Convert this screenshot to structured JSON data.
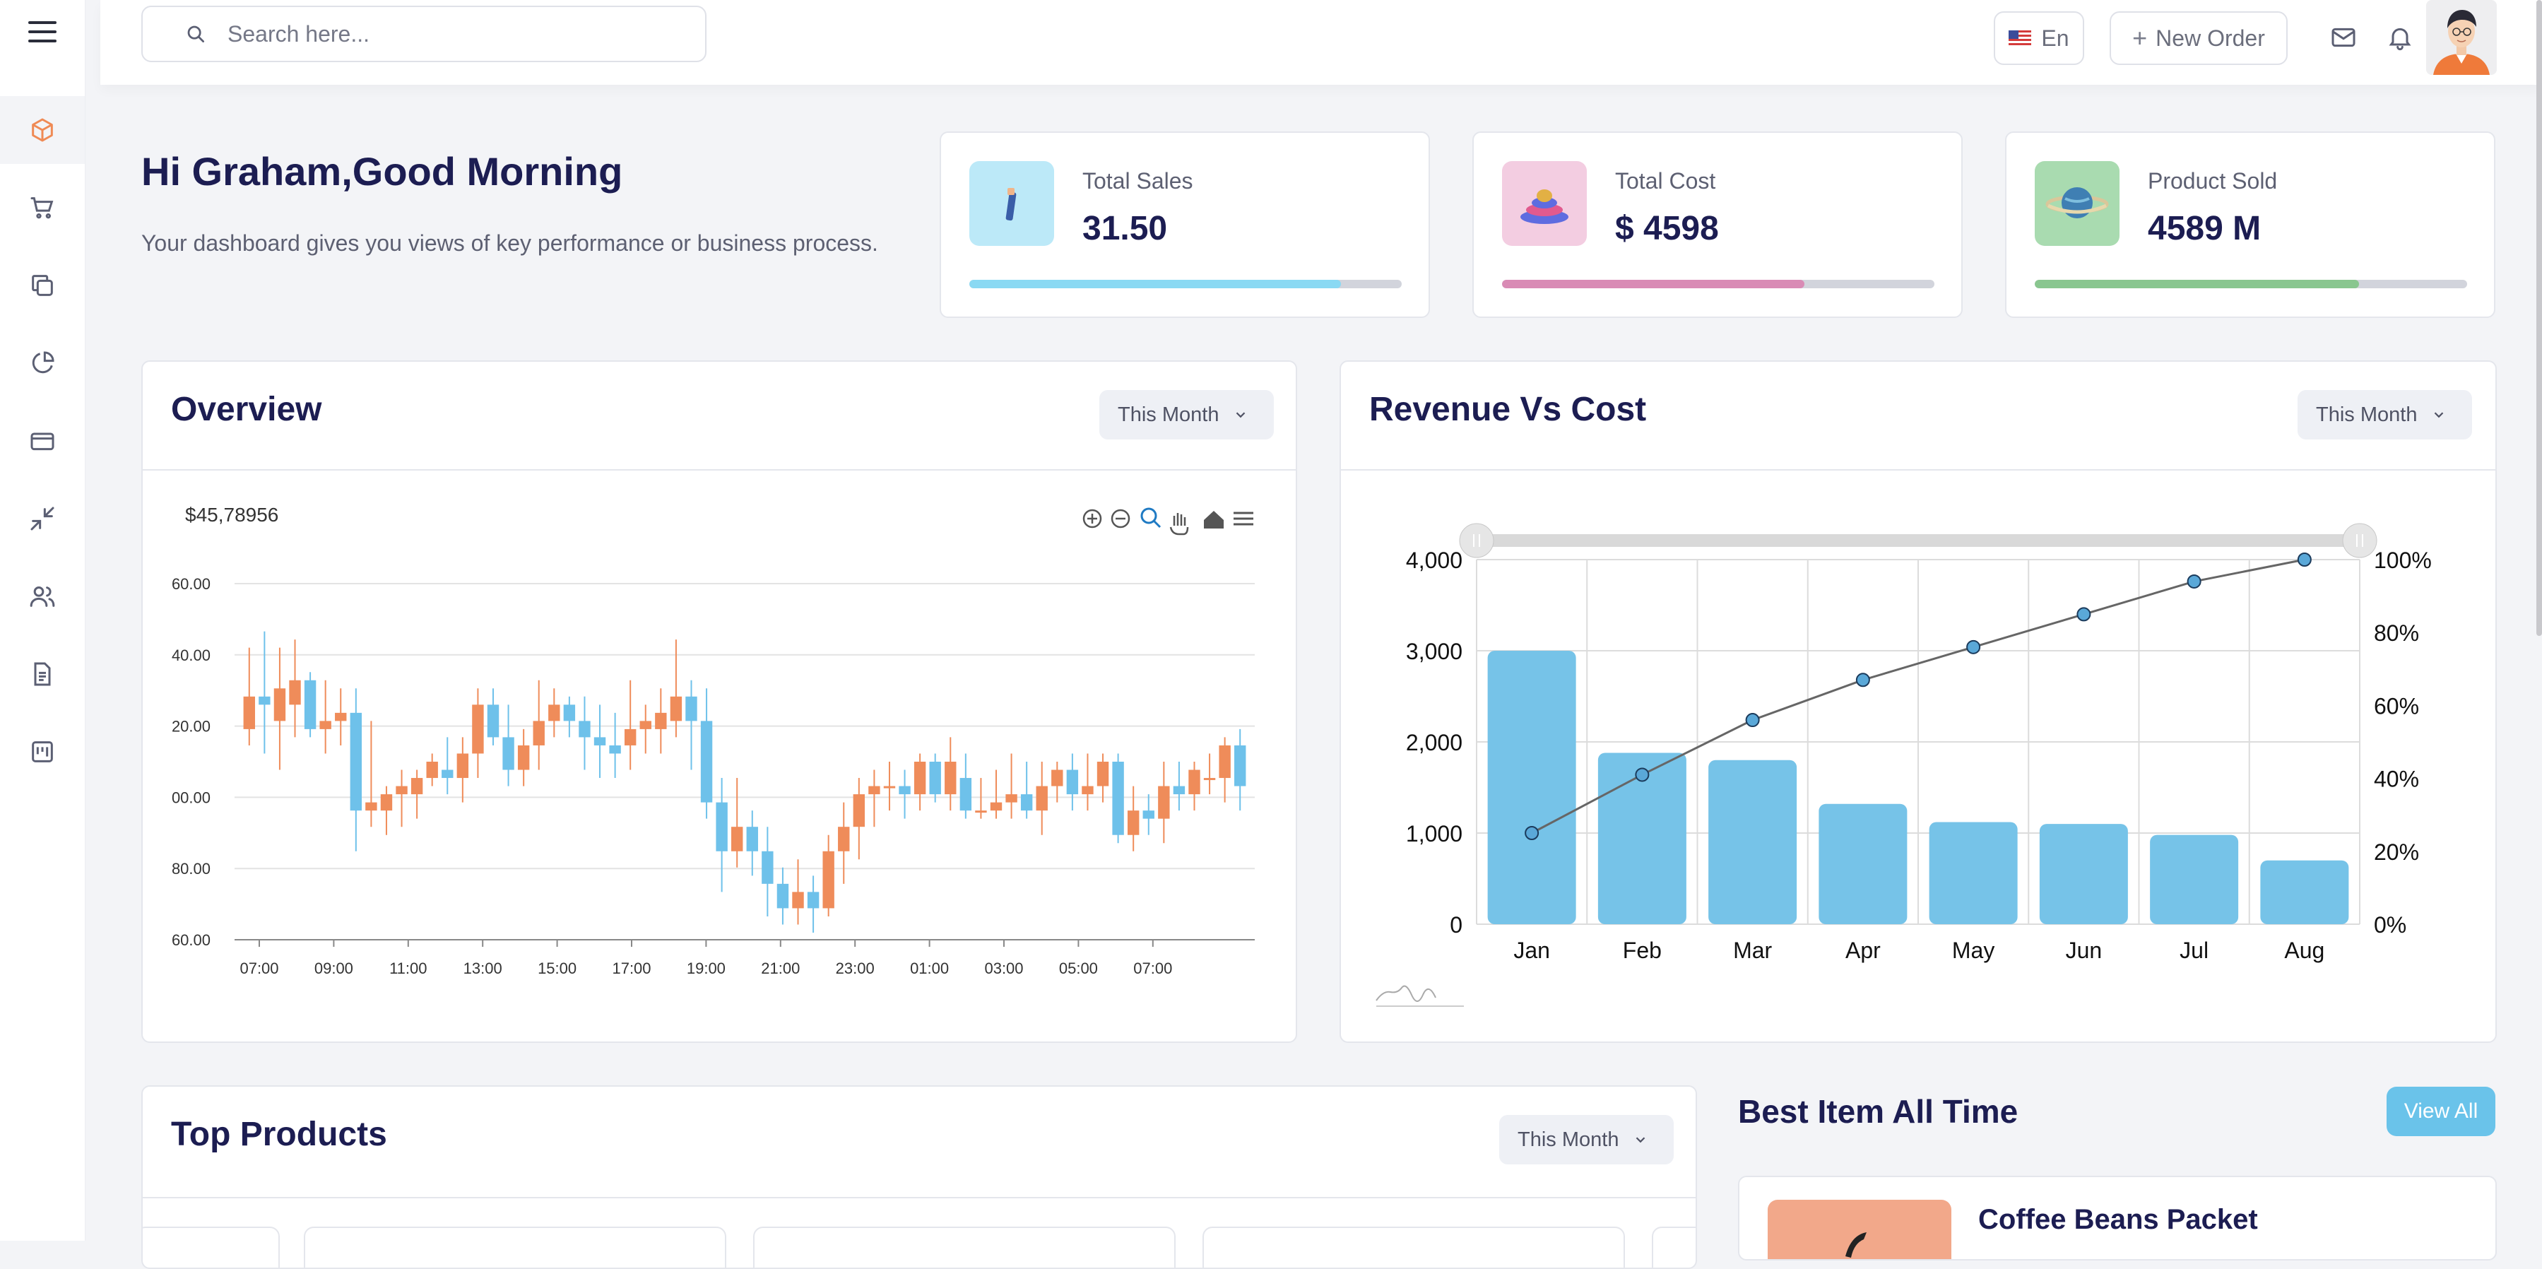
{
  "search": {
    "placeholder": "Search here..."
  },
  "header": {
    "language": "En",
    "new_order": "New Order"
  },
  "sidebar": {
    "items": [
      {
        "name": "box-icon",
        "active": true
      },
      {
        "name": "cart-icon"
      },
      {
        "name": "copy-icon"
      },
      {
        "name": "pie-chart-icon"
      },
      {
        "name": "credit-card-icon"
      },
      {
        "name": "minimize-icon"
      },
      {
        "name": "users-icon"
      },
      {
        "name": "document-icon"
      },
      {
        "name": "board-icon"
      }
    ]
  },
  "greeting": {
    "title": "Hi Graham,Good Morning",
    "subtitle": "Your dashboard gives you views of key performance or business process."
  },
  "stats": [
    {
      "label": "Total Sales",
      "value": "31.50",
      "progress": 0.86,
      "color": "#8ad9f3",
      "icon_bg": "#bce9f8"
    },
    {
      "label": "Total Cost",
      "value": "$ 4598",
      "progress": 0.7,
      "color": "#d98bb5",
      "icon_bg": "#f3cde1"
    },
    {
      "label": "Product Sold",
      "value": "4589 M",
      "progress": 0.75,
      "color": "#89c68f",
      "icon_bg": "#a9dbb0"
    }
  ],
  "overview": {
    "title": "Overview",
    "period": "This Month",
    "price_label": "$45,78956"
  },
  "revenue": {
    "title": "Revenue Vs Cost",
    "period": "This Month"
  },
  "top_products": {
    "title": "Top Products",
    "period": "This Month"
  },
  "best_item": {
    "title": "Best Item All Time",
    "view_all": "View All",
    "first_item": "Coffee Beans Packet"
  },
  "chart_data": [
    {
      "type": "candlestick",
      "y_ticks": [
        "60.00",
        "40.00",
        "20.00",
        "00.00",
        "80.00",
        "60.00"
      ],
      "x_ticks": [
        "07:00",
        "09:00",
        "11:00",
        "13:00",
        "15:00",
        "17:00",
        "19:00",
        "21:00",
        "23:00",
        "01:00",
        "03:00",
        "05:00",
        "07:00"
      ],
      "up_color": "#ef8c5a",
      "down_color": "#6ec1ea",
      "candles": [
        [
          10,
          18,
          6,
          30
        ],
        [
          18,
          16,
          4,
          34
        ],
        [
          12,
          20,
          0,
          30
        ],
        [
          16,
          22,
          8,
          32
        ],
        [
          22,
          10,
          8,
          24
        ],
        [
          10,
          12,
          4,
          22
        ],
        [
          12,
          14,
          6,
          20
        ],
        [
          14,
          -10,
          -20,
          20
        ],
        [
          -10,
          -8,
          -14,
          12
        ],
        [
          -10,
          -6,
          -16,
          -4
        ],
        [
          -6,
          -4,
          -14,
          0
        ],
        [
          -6,
          -2,
          -12,
          0
        ],
        [
          -2,
          2,
          -4,
          4
        ],
        [
          0,
          -2,
          -6,
          8
        ],
        [
          -2,
          4,
          -8,
          8
        ],
        [
          4,
          16,
          -2,
          20
        ],
        [
          16,
          8,
          6,
          20
        ],
        [
          8,
          0,
          -4,
          16
        ],
        [
          0,
          6,
          -4,
          10
        ],
        [
          6,
          12,
          0,
          22
        ],
        [
          12,
          16,
          8,
          20
        ],
        [
          16,
          12,
          8,
          18
        ],
        [
          12,
          8,
          0,
          18
        ],
        [
          8,
          6,
          -2,
          16
        ],
        [
          6,
          4,
          -2,
          14
        ],
        [
          6,
          10,
          0,
          22
        ],
        [
          10,
          12,
          4,
          16
        ],
        [
          10,
          14,
          4,
          20
        ],
        [
          12,
          18,
          8,
          32
        ],
        [
          18,
          12,
          0,
          22
        ],
        [
          12,
          -8,
          -12,
          20
        ],
        [
          -8,
          -20,
          -30,
          -2
        ],
        [
          -20,
          -14,
          -24,
          -2
        ],
        [
          -14,
          -20,
          -26,
          -10
        ],
        [
          -20,
          -28,
          -36,
          -14
        ],
        [
          -28,
          -34,
          -38,
          -24
        ],
        [
          -34,
          -30,
          -38,
          -22
        ],
        [
          -30,
          -34,
          -40,
          -26
        ],
        [
          -34,
          -20,
          -36,
          -16
        ],
        [
          -20,
          -14,
          -28,
          -8
        ],
        [
          -14,
          -6,
          -22,
          -2
        ],
        [
          -6,
          -4,
          -14,
          0
        ],
        [
          -4,
          -4,
          -10,
          2
        ],
        [
          -4,
          -6,
          -12,
          0
        ],
        [
          -6,
          2,
          -10,
          4
        ],
        [
          2,
          -6,
          -8,
          4
        ],
        [
          -6,
          2,
          -10,
          8
        ],
        [
          -2,
          -10,
          -12,
          4
        ],
        [
          -10,
          -10,
          -12,
          -2
        ],
        [
          -10,
          -8,
          -12,
          0
        ],
        [
          -8,
          -6,
          -12,
          4
        ],
        [
          -6,
          -10,
          -12,
          2
        ],
        [
          -10,
          -4,
          -16,
          2
        ],
        [
          -4,
          0,
          -8,
          2
        ],
        [
          0,
          -6,
          -10,
          4
        ],
        [
          -6,
          -4,
          -10,
          4
        ],
        [
          -4,
          2,
          -8,
          4
        ],
        [
          2,
          -16,
          -18,
          4
        ],
        [
          -16,
          -10,
          -20,
          -4
        ],
        [
          -10,
          -12,
          -16,
          -6
        ],
        [
          -12,
          -4,
          -18,
          2
        ],
        [
          -4,
          -6,
          -10,
          2
        ],
        [
          -6,
          0,
          -10,
          2
        ],
        [
          -2,
          -2,
          -6,
          4
        ],
        [
          -2,
          6,
          -8,
          8
        ],
        [
          6,
          -4,
          -10,
          10
        ]
      ]
    },
    {
      "type": "bar+line",
      "categories": [
        "Jan",
        "Feb",
        "Mar",
        "Apr",
        "May",
        "Jun",
        "Jul",
        "Aug"
      ],
      "series": [
        {
          "type": "bar",
          "values": [
            3000,
            1880,
            1800,
            1320,
            1120,
            1100,
            980,
            700
          ],
          "color": "#76c3e8"
        },
        {
          "type": "line",
          "values": [
            25,
            41,
            56,
            67,
            76,
            85,
            94,
            100
          ]
        }
      ],
      "y_left_ticks": [
        "4,000",
        "3,000",
        "2,000",
        "1,000",
        "0"
      ],
      "y_right_ticks": [
        "100%",
        "80%",
        "60%",
        "40%",
        "20%",
        "0%"
      ],
      "ylim": [
        0,
        4000
      ],
      "y2lim": [
        0,
        100
      ]
    }
  ]
}
